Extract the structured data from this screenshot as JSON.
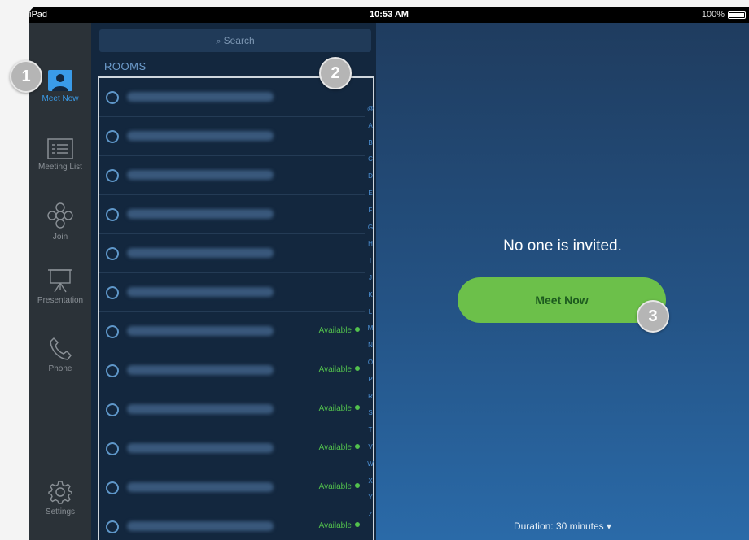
{
  "status_bar": {
    "device": "iPad",
    "time": "10:53 AM",
    "battery": "100%"
  },
  "nav": [
    {
      "label": "Meet Now",
      "icon": "person-icon",
      "active": true
    },
    {
      "label": "Meeting List",
      "icon": "list-icon"
    },
    {
      "label": "Join",
      "icon": "join-icon"
    },
    {
      "label": "Presentation",
      "icon": "presentation-icon"
    },
    {
      "label": "Phone",
      "icon": "phone-icon"
    },
    {
      "label": "Settings",
      "icon": "gear-icon"
    }
  ],
  "search": {
    "placeholder": "Search"
  },
  "rooms": {
    "header": "ROOMS",
    "items": [
      {
        "name": "",
        "status": ""
      },
      {
        "name": "",
        "status": ""
      },
      {
        "name": "",
        "status": ""
      },
      {
        "name": "",
        "status": ""
      },
      {
        "name": "",
        "status": ""
      },
      {
        "name": "",
        "status": ""
      },
      {
        "name": "",
        "status": "Available"
      },
      {
        "name": "",
        "status": "Available"
      },
      {
        "name": "",
        "status": "Available"
      },
      {
        "name": "",
        "status": "Available"
      },
      {
        "name": "",
        "status": "Available"
      },
      {
        "name": "",
        "status": "Available"
      }
    ],
    "index_letters": [
      "@",
      "A",
      "B",
      "C",
      "D",
      "E",
      "F",
      "G",
      "H",
      "I",
      "J",
      "K",
      "L",
      "M",
      "N",
      "O",
      "P",
      "R",
      "S",
      "T",
      "V",
      "W",
      "X",
      "Y",
      "Z"
    ]
  },
  "main": {
    "message": "No one is invited.",
    "meet_button": "Meet Now",
    "duration": "Duration: 30 minutes ▾"
  },
  "callouts": [
    "1",
    "2",
    "3"
  ],
  "colors": {
    "accent_blue": "#3a9be8",
    "available_green": "#53c24d",
    "meet_button": "#6cc04a"
  }
}
